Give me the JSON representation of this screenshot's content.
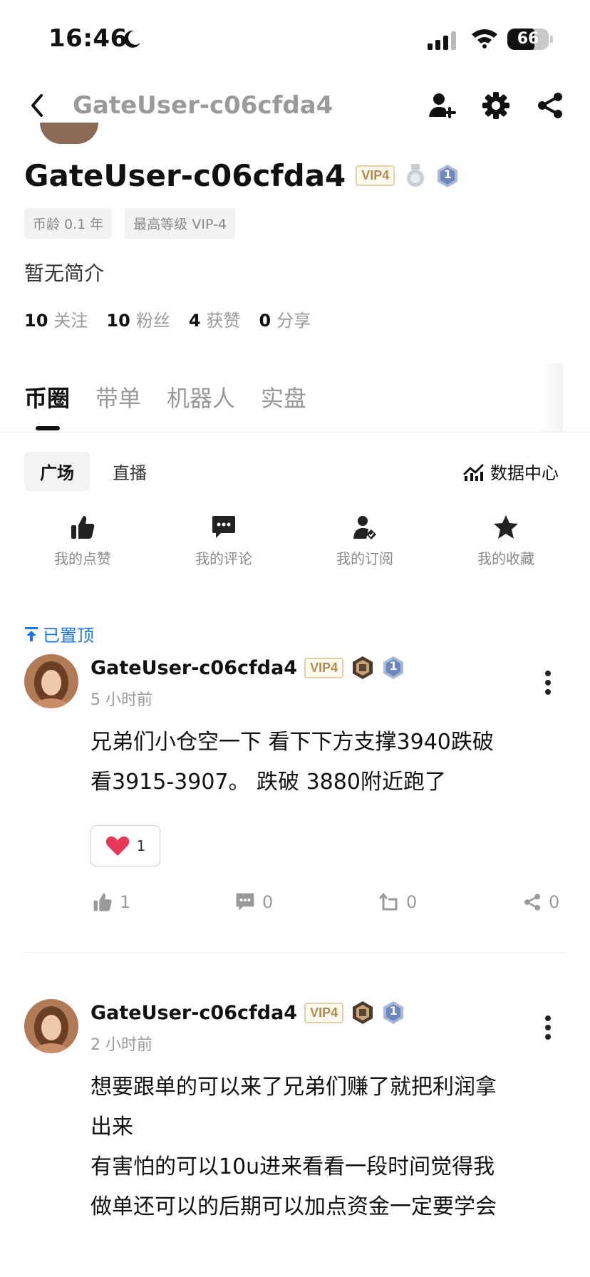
{
  "status_bar": {
    "time": "16:46",
    "battery": "66"
  },
  "nav": {
    "title": "GateUser-c06cfda4"
  },
  "profile": {
    "name": "GateUser-c06cfda4",
    "vip": "VIP4",
    "rank_badge": "1",
    "tags": [
      "币龄 0.1 年",
      "最高等级 VIP-4"
    ],
    "intro": "暂无简介",
    "stats": [
      {
        "n": "10",
        "label": "关注"
      },
      {
        "n": "10",
        "label": "粉丝"
      },
      {
        "n": "4",
        "label": "获赞"
      },
      {
        "n": "0",
        "label": "分享"
      }
    ]
  },
  "tabs": [
    "币圈",
    "带单",
    "机器人",
    "实盘"
  ],
  "subtabs": [
    "广场",
    "直播"
  ],
  "data_center": "数据中心",
  "quick_actions": [
    {
      "label": "我的点赞",
      "icon": "thumbs-up-icon"
    },
    {
      "label": "我的评论",
      "icon": "comment-icon"
    },
    {
      "label": "我的订阅",
      "icon": "subscribe-icon"
    },
    {
      "label": "我的收藏",
      "icon": "star-icon"
    }
  ],
  "pinned_label": "已置顶",
  "posts": [
    {
      "name": "GateUser-c06cfda4",
      "vip": "VIP4",
      "rank": "1",
      "time": "5 小时前",
      "lines": [
        "兄弟们小仓空一下 看下下方支撑3940跌破",
        "看3915-3907。 跌破 3880附近跑了"
      ],
      "heart_count": "1",
      "likes": "1",
      "comments": "0",
      "reposts": "0",
      "shares": "0"
    },
    {
      "name": "GateUser-c06cfda4",
      "vip": "VIP4",
      "rank": "1",
      "time": "2 小时前",
      "lines": [
        "想要跟单的可以来了兄弟们赚了就把利润拿",
        "出来",
        "有害怕的可以10u进来看看一段时间觉得我",
        "做单还可以的后期可以加点资金一定要学会"
      ]
    }
  ],
  "colors": {
    "accent": "#1a73e8",
    "vip_gold": "#b08a4e",
    "heart": "#e8385a"
  }
}
